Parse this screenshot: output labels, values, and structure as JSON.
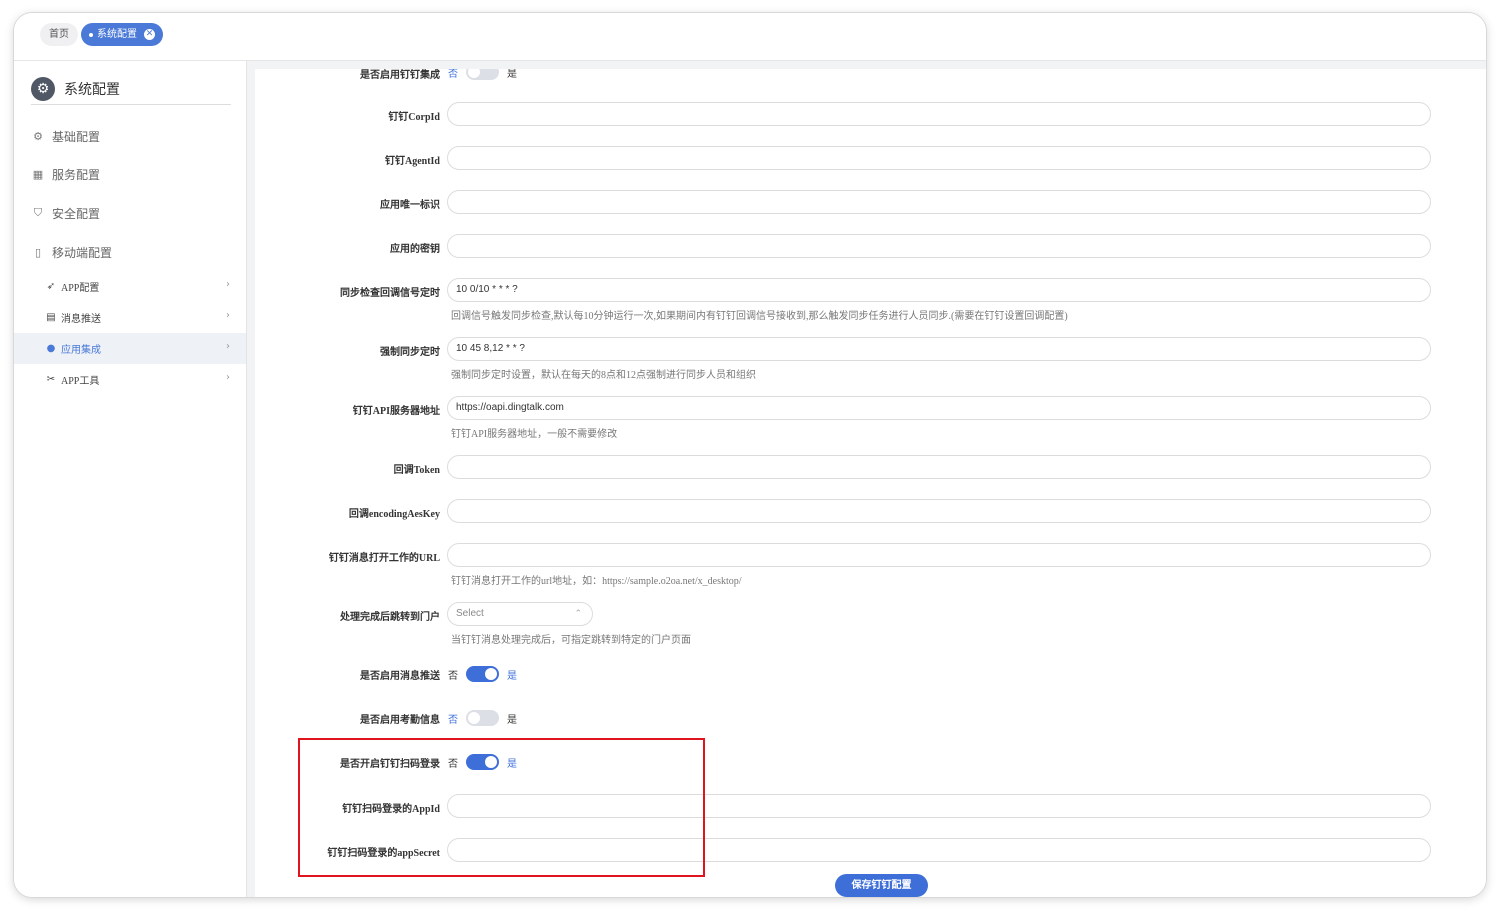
{
  "tabs": {
    "home": "首页",
    "active": "系统配置",
    "close_icon": "close-icon"
  },
  "sidebar": {
    "title": "系统配置",
    "title_icon": "gear-icon",
    "items": [
      {
        "label": "基础配置",
        "icon": "gear-icon"
      },
      {
        "label": "服务配置",
        "icon": "service-icon"
      },
      {
        "label": "安全配置",
        "icon": "shield-icon"
      },
      {
        "label": "移动端配置",
        "icon": "mobile-icon"
      }
    ],
    "sub_items": [
      {
        "label": "APP配置",
        "icon": "rocket-icon"
      },
      {
        "label": "消息推送",
        "icon": "message-icon"
      },
      {
        "label": "应用集成",
        "icon": "circle-icon",
        "active": true
      },
      {
        "label": "APP工具",
        "icon": "tools-icon"
      }
    ]
  },
  "form": {
    "top_toggle": {
      "label": "是否启用钉钉集成",
      "no": "否",
      "yes": "是",
      "on": false
    },
    "corpid": {
      "label": "钉钉CorpId",
      "value": ""
    },
    "agentid": {
      "label": "钉钉AgentId",
      "value": ""
    },
    "app_key": {
      "label": "应用唯一标识",
      "value": ""
    },
    "app_secret": {
      "label": "应用的密钥",
      "value": ""
    },
    "sync_check": {
      "label": "同步检查回调信号定时",
      "value": "10 0/10 * * * ?",
      "hint": "回调信号触发同步检查,默认每10分钟运行一次,如果期间内有钉钉回调信号接收到,那么触发同步任务进行人员同步.(需要在钉钉设置回调配置)"
    },
    "force_sync": {
      "label": "强制同步定时",
      "value": "10 45 8,12 * * ?",
      "hint": "强制同步定时设置，默认在每天的8点和12点强制进行同步人员和组织"
    },
    "api_server": {
      "label": "钉钉API服务器地址",
      "value": "https://oapi.dingtalk.com",
      "hint": "钉钉API服务器地址，一般不需要修改"
    },
    "callback_token": {
      "label": "回调Token",
      "value": ""
    },
    "callback_aes": {
      "label": "回调encodingAesKey",
      "value": ""
    },
    "msg_url": {
      "label": "钉钉消息打开工作的URL",
      "value": "",
      "hint": "钉钉消息打开工作的url地址，如：https://sample.o2oa.net/x_desktop/"
    },
    "portal": {
      "label": "处理完成后跳转到门户",
      "placeholder": "Select",
      "hint": "当钉钉消息处理完成后，可指定跳转到特定的门户页面"
    },
    "msg_push": {
      "label": "是否启用消息推送",
      "no": "否",
      "yes": "是",
      "on": true
    },
    "attendance": {
      "label": "是否启用考勤信息",
      "no": "否",
      "yes": "是",
      "on": false
    },
    "qr_login": {
      "label": "是否开启钉钉扫码登录",
      "no": "否",
      "yes": "是",
      "on": true
    },
    "qr_appid": {
      "label": "钉钉扫码登录的AppId",
      "value": ""
    },
    "qr_secret": {
      "label": "钉钉扫码登录的appSecret",
      "value": ""
    },
    "save_label": "保存钉钉配置"
  },
  "colors": {
    "accent": "#3e6fd8",
    "highlight": "#e0141e"
  }
}
